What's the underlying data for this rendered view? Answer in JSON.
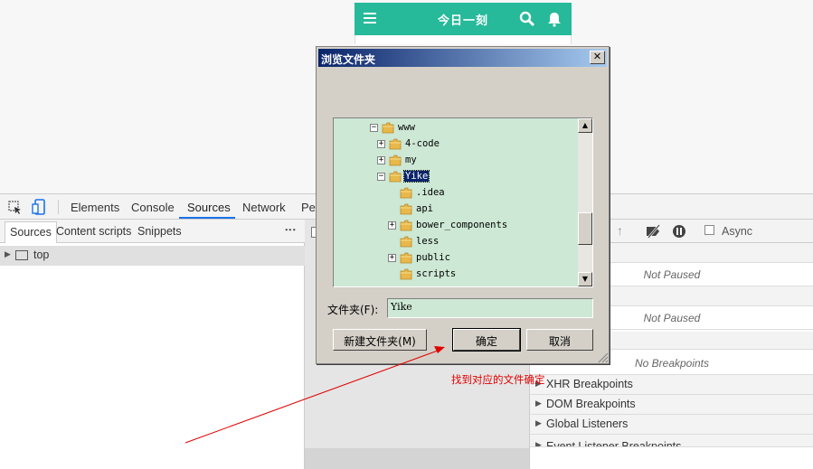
{
  "app": {
    "title": "今日一刻"
  },
  "devtools": {
    "tabs": [
      "Elements",
      "Console",
      "Sources",
      "Network",
      "Per"
    ],
    "active_tab": "Sources",
    "subtabs": [
      "Sources",
      "Content scripts",
      "Snippets"
    ],
    "tree_top": "top",
    "right": {
      "async_label": "Async",
      "status_1": "Not Paused",
      "status_2": "Not Paused",
      "breakpoints_partial": "Breakpoints",
      "breakpoints_status": "No Breakpoints",
      "sections": [
        "XHR Breakpoints",
        "DOM Breakpoints",
        "Global Listeners",
        "Event Listener Breakpoints"
      ]
    }
  },
  "dialog": {
    "title": "浏览文件夹",
    "close": "✕",
    "folder_label": "文件夹(F):",
    "folder_value": "Yike",
    "new_folder": "新建文件夹(M)",
    "ok": "确定",
    "cancel": "取消",
    "tree": [
      {
        "name": "www",
        "toggle": "−",
        "level": 0
      },
      {
        "name": "4-code",
        "toggle": "+",
        "level": 1
      },
      {
        "name": "my",
        "toggle": "+",
        "level": 1
      },
      {
        "name": "Yike",
        "toggle": "−",
        "level": 1,
        "selected": true
      },
      {
        "name": ".idea",
        "toggle": "",
        "level": 2
      },
      {
        "name": "api",
        "toggle": "",
        "level": 2
      },
      {
        "name": "bower_components",
        "toggle": "+",
        "level": 2
      },
      {
        "name": "less",
        "toggle": "",
        "level": 2
      },
      {
        "name": "public",
        "toggle": "+",
        "level": 2
      },
      {
        "name": "scripts",
        "toggle": "",
        "level": 2
      }
    ]
  },
  "annotation": "找到对应的文件确定",
  "colors": {
    "app_header": "#26b99a",
    "tree_bg": "#cde8d4",
    "annotation": "#e00000"
  }
}
